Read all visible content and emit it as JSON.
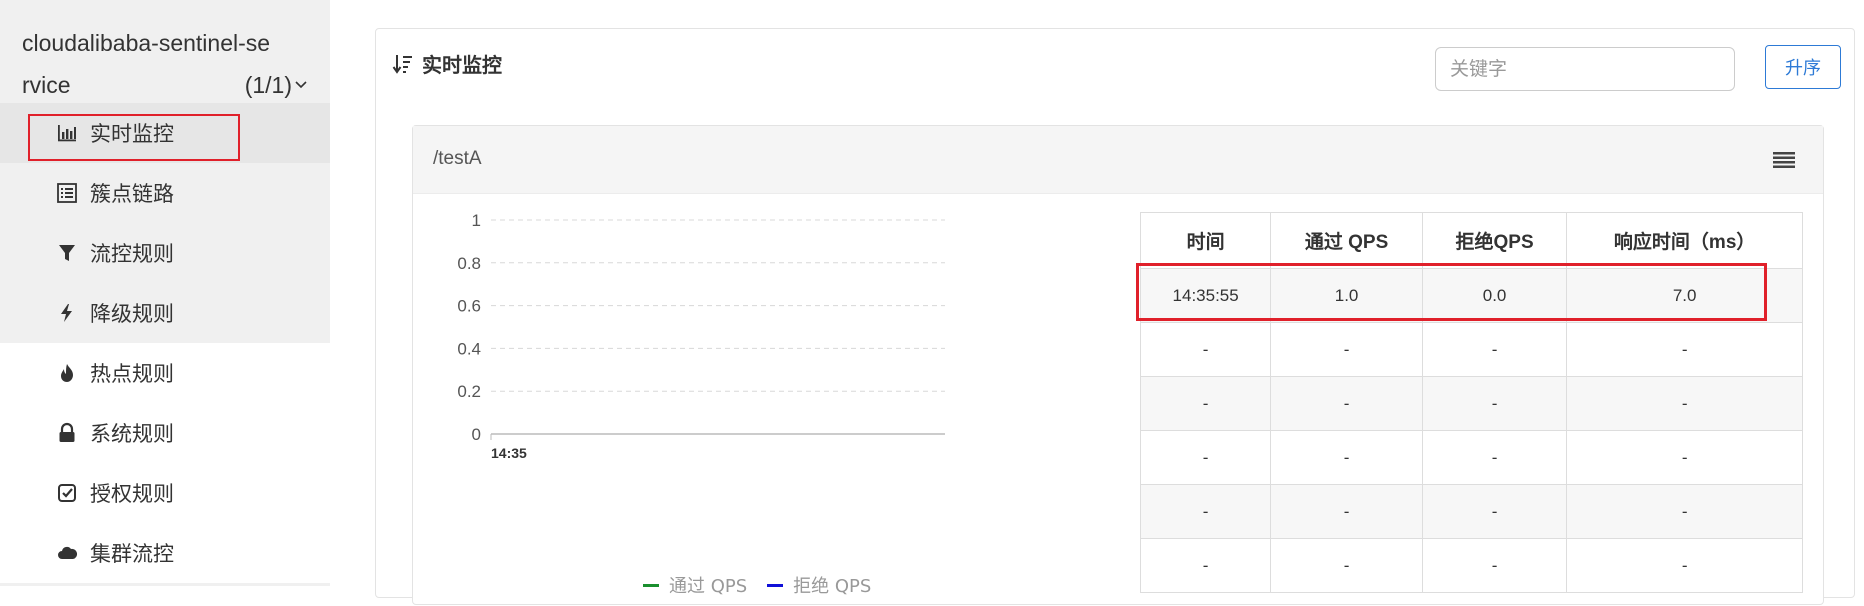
{
  "sidebar": {
    "app_name": "cloudalibaba-sentinel-service",
    "app_count": "(1/1)",
    "items": [
      {
        "label": "实时监控",
        "icon": "bar-chart-icon"
      },
      {
        "label": "簇点链路",
        "icon": "list-icon"
      },
      {
        "label": "流控规则",
        "icon": "filter-icon"
      },
      {
        "label": "降级规则",
        "icon": "bolt-icon"
      },
      {
        "label": "热点规则",
        "icon": "fire-icon"
      },
      {
        "label": "系统规则",
        "icon": "lock-icon"
      },
      {
        "label": "授权规则",
        "icon": "check-square-icon"
      },
      {
        "label": "集群流控",
        "icon": "cloud-icon"
      }
    ],
    "active_index": 0
  },
  "panel": {
    "title": "实时监控",
    "search_placeholder": "关键字",
    "sort_label": "升序"
  },
  "resource": {
    "name": "/testA"
  },
  "chart_data": {
    "type": "line",
    "x": [
      "14:35"
    ],
    "ylim": [
      0,
      1
    ],
    "yticks": [
      "1",
      "0.8",
      "0.6",
      "0.4",
      "0.2",
      "0"
    ],
    "series": [
      {
        "name": "通过 QPS",
        "color": "#1a8f2e",
        "values": []
      },
      {
        "name": "拒绝 QPS",
        "color": "#1010d8",
        "values": []
      }
    ],
    "grid": true,
    "legend": "bottom"
  },
  "table": {
    "columns": [
      "时间",
      "通过 QPS",
      "拒绝QPS",
      "响应时间（ms）"
    ],
    "rows": [
      [
        "14:35:55",
        "1.0",
        "0.0",
        "7.0"
      ],
      [
        "-",
        "-",
        "-",
        "-"
      ],
      [
        "-",
        "-",
        "-",
        "-"
      ],
      [
        "-",
        "-",
        "-",
        "-"
      ],
      [
        "-",
        "-",
        "-",
        "-"
      ],
      [
        "-",
        "-",
        "-",
        "-"
      ]
    ]
  },
  "colors": {
    "accent": "#2d7ad6",
    "highlight": "#e0202a"
  }
}
